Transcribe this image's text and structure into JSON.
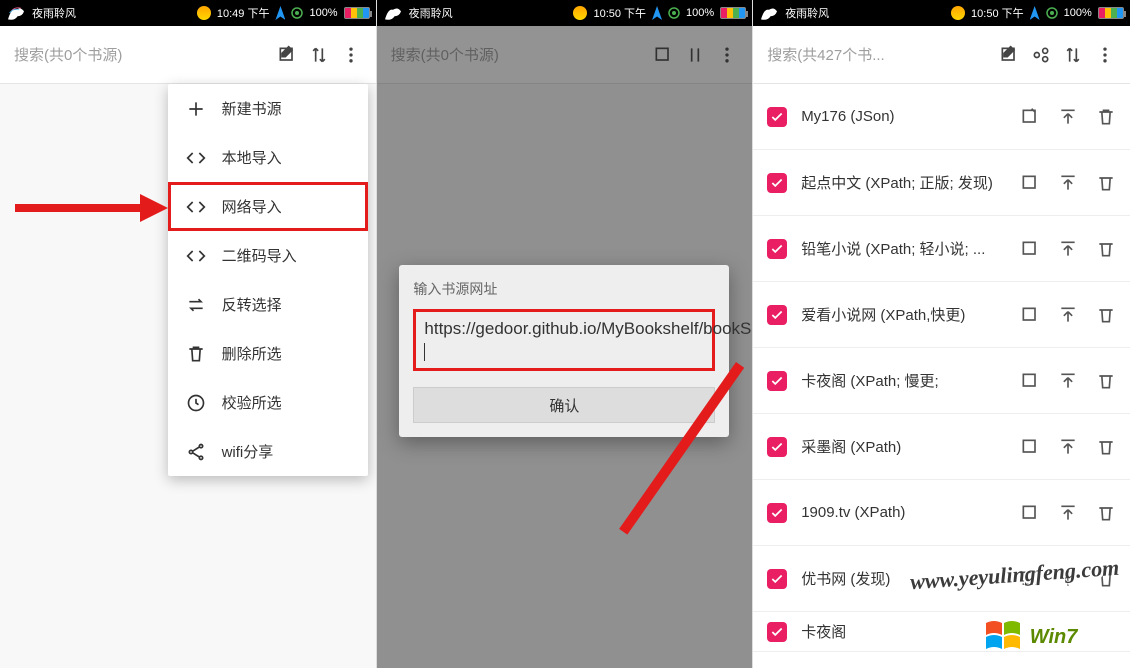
{
  "status": {
    "carrier": "夜雨聆风",
    "time1": "10:49 下午",
    "time2": "10:50 下午",
    "time3": "10:50 下午",
    "battery": "100%",
    "signal_icon": "signal"
  },
  "pane1": {
    "search_placeholder": "搜索(共0个书源)",
    "menu": {
      "new_source": "新建书源",
      "local_import": "本地导入",
      "network_import": "网络导入",
      "qr_import": "二维码导入",
      "invert_selection": "反转选择",
      "delete_selected": "删除所选",
      "verify_selected": "校验所选",
      "wifi_share": "wifi分享"
    }
  },
  "pane2": {
    "search_placeholder": "搜索(共0个书源)",
    "dialog_title": "输入书源网址",
    "url": "https://gedoor.github.io/MyBookshelf/bookSource.json",
    "confirm": "确认"
  },
  "pane3": {
    "search_placeholder": "搜索(共427个书...",
    "sources": [
      {
        "name": "My176 (JSon)"
      },
      {
        "name": "起点中文 (XPath; 正版; 发现)"
      },
      {
        "name": "铅笔小说 (XPath; 轻小说; ..."
      },
      {
        "name": "爱看小说网 (XPath,快更)"
      },
      {
        "name": "卡夜阁 (XPath; 慢更;"
      },
      {
        "name": "采墨阁 (XPath)"
      },
      {
        "name": "1909.tv (XPath)"
      },
      {
        "name": "优书网 (发现)"
      },
      {
        "name": "卡夜阁"
      }
    ]
  },
  "watermark": "www.yeyulingfeng.com",
  "win_label": "Win7"
}
